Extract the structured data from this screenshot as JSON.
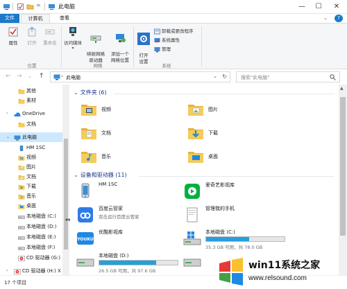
{
  "window": {
    "title": "此电脑",
    "controls": {
      "minimize": "—",
      "maximize": "☐",
      "close": "✕"
    }
  },
  "ribbon": {
    "tabs": [
      {
        "label": "文件",
        "active": false
      },
      {
        "label": "计算机",
        "active": true
      },
      {
        "label": "查看",
        "active": false
      }
    ],
    "groups": {
      "location": {
        "label": "位置",
        "buttons": [
          {
            "label": "属性",
            "icon": "properties-icon",
            "enabled": true
          },
          {
            "label": "打开",
            "icon": "open-icon",
            "enabled": false
          },
          {
            "label": "重命名",
            "icon": "rename-icon",
            "enabled": false
          }
        ]
      },
      "network": {
        "label": "网络",
        "buttons": [
          {
            "label": "访问媒体",
            "icon": "media-icon"
          },
          {
            "label": "映射网络\n驱动器",
            "icon": "map-drive-icon"
          },
          {
            "label": "添加一个\n网络位置",
            "icon": "add-network-location-icon"
          }
        ]
      },
      "system": {
        "label": "系统",
        "open_settings": "打开\n设置",
        "items": [
          "卸载或更改程序",
          "系统属性",
          "管理"
        ]
      }
    }
  },
  "address": {
    "path": "此电脑",
    "search_placeholder": "搜索\"此电脑\""
  },
  "nav": [
    {
      "label": "其他",
      "icon": "folder-icon",
      "indent": 2,
      "selected": false
    },
    {
      "label": "素材",
      "icon": "folder-icon",
      "indent": 2,
      "selected": false
    },
    {
      "label": "OneDrive",
      "icon": "onedrive-icon",
      "indent": 1,
      "selected": false
    },
    {
      "label": "文档",
      "icon": "folder-icon",
      "indent": 2,
      "selected": false
    },
    {
      "label": "此电脑",
      "icon": "computer-icon",
      "indent": 1,
      "selected": true
    },
    {
      "label": "HM 1SC",
      "icon": "phone-icon",
      "indent": 2,
      "selected": false
    },
    {
      "label": "视频",
      "icon": "video-folder-icon",
      "indent": 2,
      "selected": false
    },
    {
      "label": "图片",
      "icon": "pictures-folder-icon",
      "indent": 2,
      "selected": false
    },
    {
      "label": "文档",
      "icon": "documents-folder-icon",
      "indent": 2,
      "selected": false
    },
    {
      "label": "下载",
      "icon": "downloads-folder-icon",
      "indent": 2,
      "selected": false
    },
    {
      "label": "音乐",
      "icon": "music-folder-icon",
      "indent": 2,
      "selected": false
    },
    {
      "label": "桌面",
      "icon": "desktop-folder-icon",
      "indent": 2,
      "selected": false
    },
    {
      "label": "本地磁盘 (C:)",
      "icon": "drive-icon",
      "indent": 2,
      "selected": false
    },
    {
      "label": "本地磁盘 (D:)",
      "icon": "drive-icon",
      "indent": 2,
      "selected": false
    },
    {
      "label": "本地磁盘 (E:)",
      "icon": "drive-icon",
      "indent": 2,
      "selected": false
    },
    {
      "label": "本地磁盘 (F:)",
      "icon": "drive-icon",
      "indent": 2,
      "selected": false
    },
    {
      "label": "CD 驱动器 (G:)",
      "icon": "cd-drive-icon",
      "indent": 2,
      "selected": false
    },
    {
      "label": "CD 驱动器 (H:) X",
      "icon": "cd-drive-icon",
      "indent": 1,
      "selected": false
    }
  ],
  "content": {
    "folders_header": "文件夹 (6)",
    "folders": [
      {
        "label": "视频",
        "icon": "video-folder-icon"
      },
      {
        "label": "图片",
        "icon": "pictures-folder-icon"
      },
      {
        "label": "文档",
        "icon": "documents-folder-icon"
      },
      {
        "label": "下载",
        "icon": "downloads-folder-icon"
      },
      {
        "label": "音乐",
        "icon": "music-folder-icon"
      },
      {
        "label": "桌面",
        "icon": "desktop-folder-icon"
      }
    ],
    "devices_header": "设备和驱动器 (11)",
    "devices": [
      {
        "name": "HM 1SC",
        "sub": "",
        "icon": "phone-icon",
        "has_bar": false
      },
      {
        "name": "爱奇艺影视库",
        "sub": "",
        "icon": "iqiyi-icon",
        "has_bar": false
      },
      {
        "name": "百度云管家",
        "sub": "双击运行百度云管家",
        "icon": "baidu-cloud-icon",
        "has_bar": false
      },
      {
        "name": "管理我的手机",
        "sub": "",
        "icon": "phone-manager-icon",
        "has_bar": false
      },
      {
        "name": "优酷影视库",
        "sub": "",
        "icon": "youku-icon",
        "has_bar": false
      },
      {
        "name": "本地磁盘 (C:)",
        "sub": "",
        "icon": "windows-drive-icon",
        "has_bar": true,
        "used_fraction": 0.55,
        "capacity": "35.3 GB 可用，共 78.0 GB"
      },
      {
        "name": "本地磁盘 (D:)",
        "sub": "",
        "icon": "drive-icon",
        "has_bar": true,
        "used_fraction": 0.73,
        "capacity": "26.5 GB 可用，共 97.6 GB"
      },
      {
        "name": "",
        "sub": "",
        "icon": "drive-icon",
        "has_bar": false
      }
    ]
  },
  "status": {
    "item_count": "17 个项目"
  },
  "watermark": {
    "title": "win11系统之家",
    "url": "www.relsound.com"
  },
  "colors": {
    "accent": "#1979ca",
    "selection": "#cce8ff",
    "drive_bar": "#26a0da",
    "folder": "#f0c14b",
    "header_text": "#1e3287"
  }
}
